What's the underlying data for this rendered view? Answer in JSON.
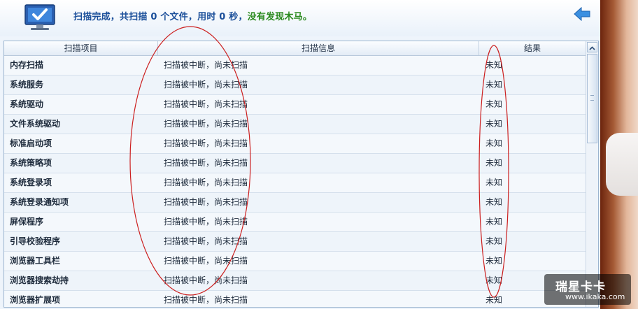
{
  "header": {
    "status_prefix": "扫描完成，共扫描",
    "file_count": "0",
    "files_unit": "个文件，用时",
    "seconds": "0",
    "seconds_unit": "秒，",
    "result_text": "没有发现木马。",
    "icon": "monitor-check-icon",
    "back_icon": "back-arrow-icon"
  },
  "table": {
    "columns": [
      "扫描项目",
      "扫描信息",
      "结果"
    ],
    "rows": [
      {
        "item": "内存扫描",
        "info": "扫描被中断，尚未扫描",
        "result": "未知"
      },
      {
        "item": "系统服务",
        "info": "扫描被中断，尚未扫描",
        "result": "未知"
      },
      {
        "item": "系统驱动",
        "info": "扫描被中断，尚未扫描",
        "result": "未知"
      },
      {
        "item": "文件系统驱动",
        "info": "扫描被中断，尚未扫描",
        "result": "未知"
      },
      {
        "item": "标准启动项",
        "info": "扫描被中断，尚未扫描",
        "result": "未知"
      },
      {
        "item": "系统策略项",
        "info": "扫描被中断，尚未扫描",
        "result": "未知"
      },
      {
        "item": "系统登录项",
        "info": "扫描被中断，尚未扫描",
        "result": "未知"
      },
      {
        "item": "系统登录通知项",
        "info": "扫描被中断，尚未扫描",
        "result": "未知"
      },
      {
        "item": "屏保程序",
        "info": "扫描被中断，尚未扫描",
        "result": "未知"
      },
      {
        "item": "引导校验程序",
        "info": "扫描被中断，尚未扫描",
        "result": "未知"
      },
      {
        "item": "浏览器工具栏",
        "info": "扫描被中断，尚未扫描",
        "result": "未知"
      },
      {
        "item": "浏览器搜索劫持",
        "info": "扫描被中断，尚未扫描",
        "result": "未知"
      },
      {
        "item": "浏览器扩展项",
        "info": "扫描被中断，尚未扫描",
        "result": "未知"
      }
    ]
  },
  "watermark": {
    "brand": "瑞星卡卡",
    "url": "www.ikaka.com"
  },
  "colors": {
    "headline": "#1b4f9a",
    "success": "#2b8a1f",
    "annotation": "#cc1f1f"
  }
}
